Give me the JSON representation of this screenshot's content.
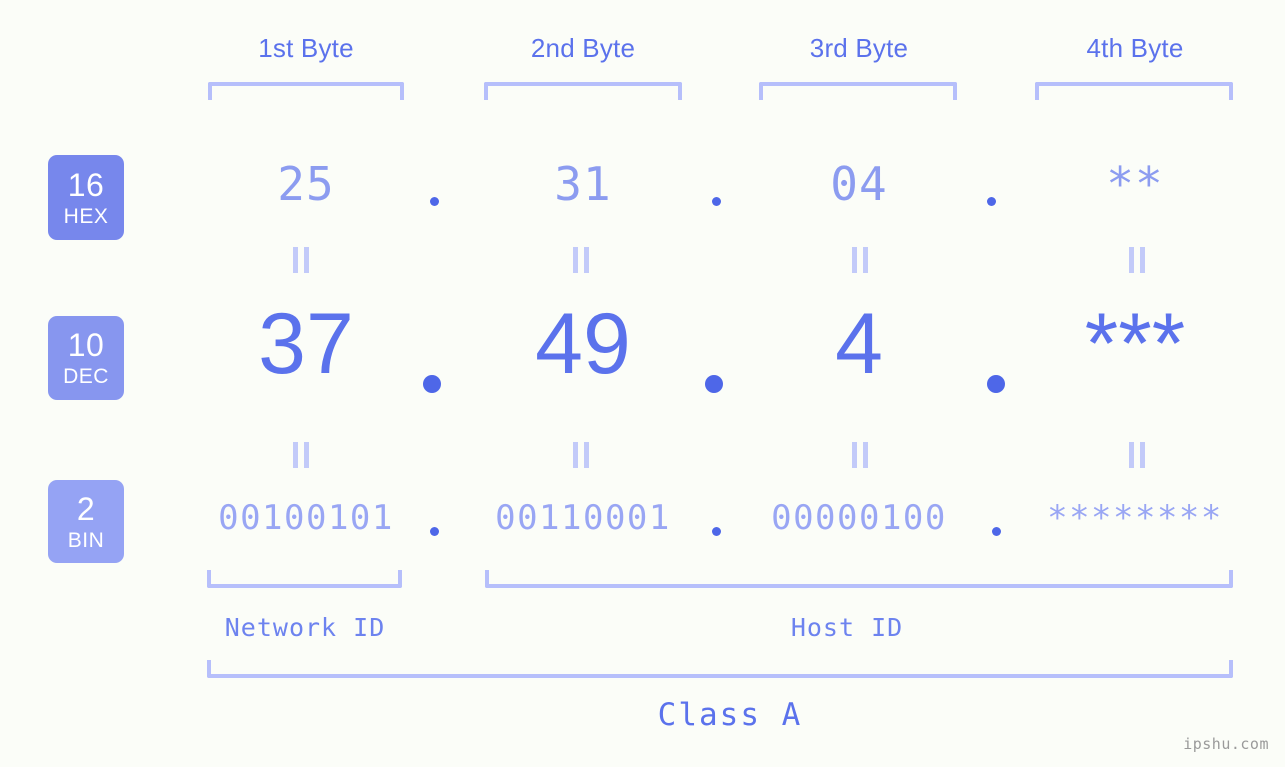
{
  "page": {
    "background_color": "#fbfdf8",
    "watermark": "ipshu.com"
  },
  "colors": {
    "accent": "#5b72ec",
    "bracket": "#b6bffb",
    "hex_value": "#8c9cf0",
    "dec_value": "#5b72ec",
    "bin_value": "#99a6f4",
    "badge_hex": "#7787ec",
    "badge_dec": "#8796ef",
    "badge_bin": "#95a3f4",
    "equals": "#c2caf9",
    "watermark": "#9a9a9a"
  },
  "byte_headers": [
    {
      "label": "1st Byte"
    },
    {
      "label": "2nd Byte"
    },
    {
      "label": "3rd Byte"
    },
    {
      "label": "4th Byte"
    }
  ],
  "rows": [
    {
      "id": "hex",
      "badge": {
        "base": "16",
        "name": "HEX"
      },
      "values": [
        "25",
        "31",
        "04",
        "**"
      ],
      "separator": "."
    },
    {
      "id": "dec",
      "badge": {
        "base": "10",
        "name": "DEC"
      },
      "values": [
        "37",
        "49",
        "4",
        "***"
      ],
      "separator": "."
    },
    {
      "id": "bin",
      "badge": {
        "base": "2",
        "name": "BIN"
      },
      "values": [
        "00100101",
        "00110001",
        "00000100",
        "********"
      ],
      "separator": "."
    }
  ],
  "equals_symbol": "=",
  "id_captions": [
    {
      "label": "Network ID"
    },
    {
      "label": "Host ID"
    }
  ],
  "class_caption": {
    "label": "Class A"
  }
}
